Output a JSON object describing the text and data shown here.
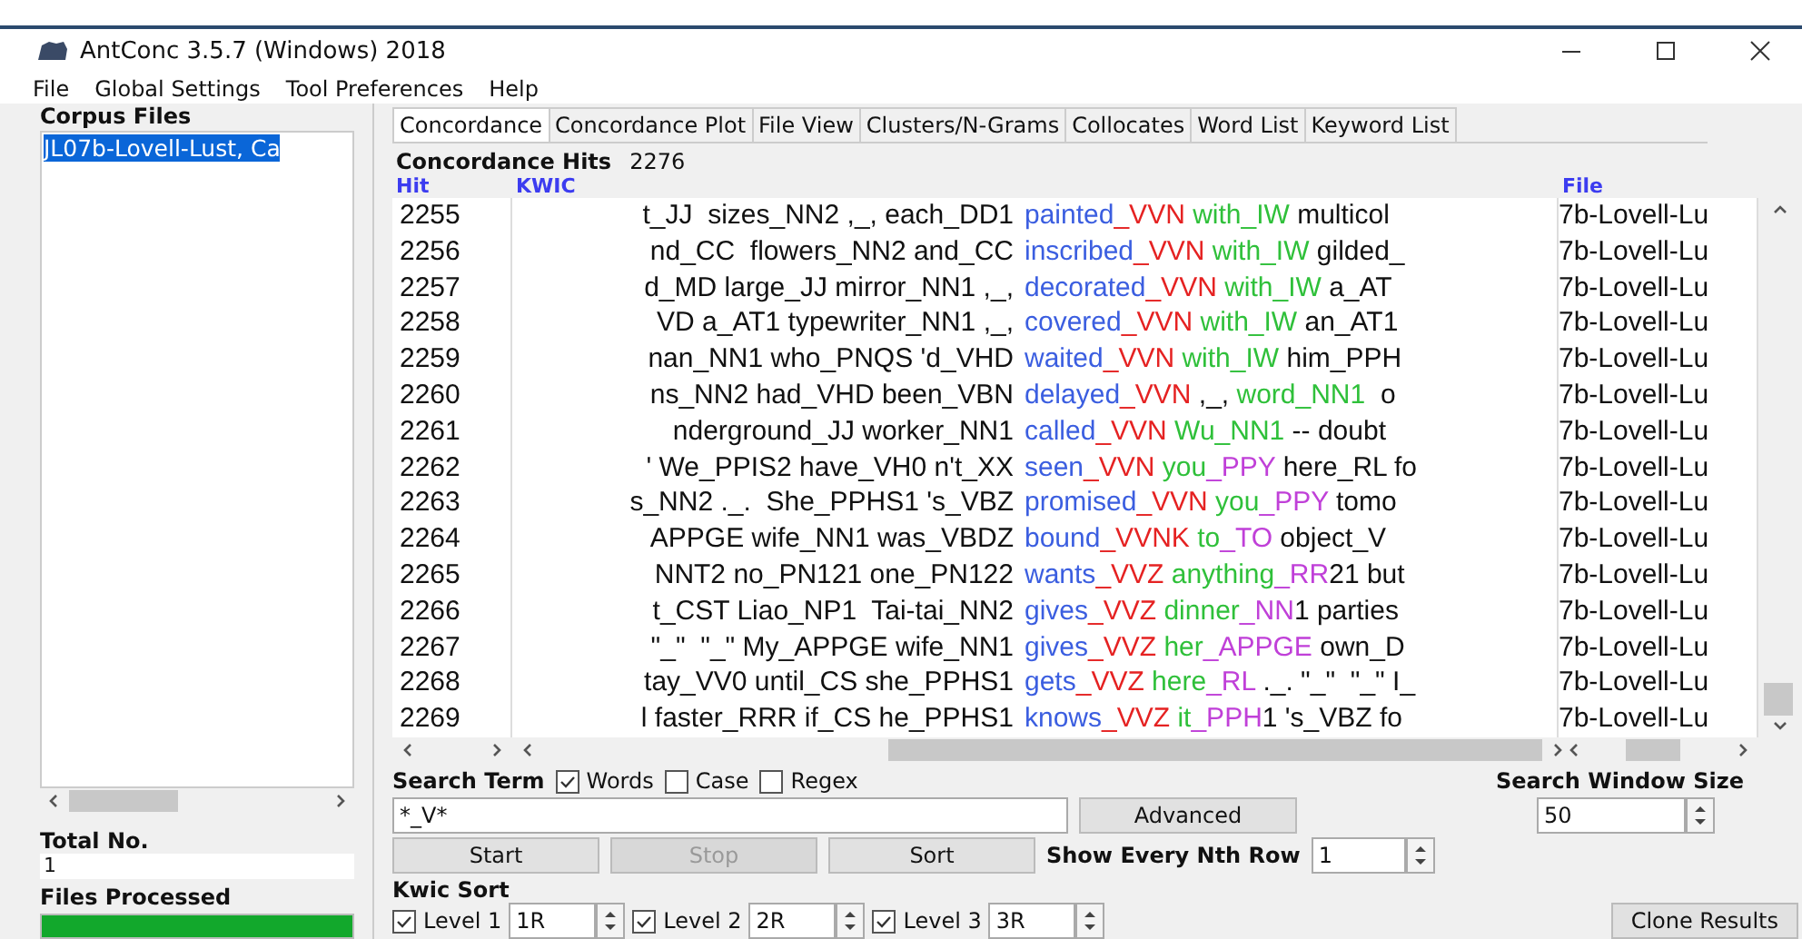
{
  "window": {
    "title": "AntConc 3.5.7 (Windows) 2018"
  },
  "menu": [
    "File",
    "Global Settings",
    "Tool Preferences",
    "Help"
  ],
  "corpus": {
    "label": "Corpus Files",
    "files": [
      {
        "name": "JL07b-Lovell-Lust, Ca",
        "selected": true
      }
    ],
    "total_label": "Total No.",
    "total": "1",
    "processed_label": "Files Processed",
    "progress": {
      "level": 1
    }
  },
  "tabs": [
    {
      "label": "Concordance",
      "selected": true
    },
    {
      "label": "Concordance Plot",
      "selected": false
    },
    {
      "label": "File View",
      "selected": false
    },
    {
      "label": "Clusters/N-Grams",
      "selected": false
    },
    {
      "label": "Collocates",
      "selected": false
    },
    {
      "label": "Word List",
      "selected": false
    },
    {
      "label": "Keyword List",
      "selected": false
    }
  ],
  "hits": {
    "label": "Concordance Hits",
    "count": "2276"
  },
  "table": {
    "columns": [
      "Hit",
      "KWIC",
      "File"
    ],
    "rows": [
      {
        "hit": "2255",
        "left": "t_JJ  sizes_NN2 ,_, each_DD1",
        "right": [
          {
            "text": "painted",
            "color": "#3b5ee0"
          },
          {
            "text": "_VVN",
            "color": "#e52222"
          },
          {
            "text": " with_IW",
            "color": "#2fc03a"
          },
          {
            "text": " multicol",
            "color": "#111111"
          }
        ],
        "file": "7b-Lovell-Lu"
      },
      {
        "hit": "2256",
        "left": "nd_CC  flowers_NN2 and_CC",
        "right": [
          {
            "text": "inscribed",
            "color": "#3b5ee0"
          },
          {
            "text": "_VVN",
            "color": "#e52222"
          },
          {
            "text": " with_IW",
            "color": "#2fc03a"
          },
          {
            "text": " gilded_",
            "color": "#111111"
          }
        ],
        "file": "7b-Lovell-Lu"
      },
      {
        "hit": "2257",
        "left": "d_MD large_JJ mirror_NN1 ,_,",
        "right": [
          {
            "text": "decorated",
            "color": "#3b5ee0"
          },
          {
            "text": "_VVN",
            "color": "#e52222"
          },
          {
            "text": " with_IW",
            "color": "#2fc03a"
          },
          {
            "text": " a_AT",
            "color": "#111111"
          }
        ],
        "file": "7b-Lovell-Lu"
      },
      {
        "hit": "2258",
        "left": "VD a_AT1 typewriter_NN1 ,_,",
        "right": [
          {
            "text": "covered",
            "color": "#3b5ee0"
          },
          {
            "text": "_VVN",
            "color": "#e52222"
          },
          {
            "text": " with_IW",
            "color": "#2fc03a"
          },
          {
            "text": " an_AT1",
            "color": "#111111"
          }
        ],
        "file": "7b-Lovell-Lu"
      },
      {
        "hit": "2259",
        "left": "nan_NN1 who_PNQS 'd_VHD",
        "right": [
          {
            "text": "waited",
            "color": "#3b5ee0"
          },
          {
            "text": "_VVN",
            "color": "#e52222"
          },
          {
            "text": " with_IW",
            "color": "#2fc03a"
          },
          {
            "text": " him_PPH",
            "color": "#111111"
          }
        ],
        "file": "7b-Lovell-Lu"
      },
      {
        "hit": "2260",
        "left": "ns_NN2 had_VHD been_VBN",
        "right": [
          {
            "text": "delayed",
            "color": "#3b5ee0"
          },
          {
            "text": "_VVN",
            "color": "#e52222"
          },
          {
            "text": " ,_, ",
            "color": "#111111"
          },
          {
            "text": "word_NN1",
            "color": "#2fc03a"
          },
          {
            "text": "  o",
            "color": "#111111"
          }
        ],
        "file": "7b-Lovell-Lu"
      },
      {
        "hit": "2261",
        "left": "nderground_JJ worker_NN1",
        "right": [
          {
            "text": "called",
            "color": "#3b5ee0"
          },
          {
            "text": "_VVN",
            "color": "#e52222"
          },
          {
            "text": " Wu_NN1",
            "color": "#2fc03a"
          },
          {
            "text": " -- doubt",
            "color": "#111111"
          }
        ],
        "file": "7b-Lovell-Lu"
      },
      {
        "hit": "2262",
        "left": "' We_PPIS2 have_VH0 n't_XX",
        "right": [
          {
            "text": "seen",
            "color": "#3b5ee0"
          },
          {
            "text": "_VVN",
            "color": "#e52222"
          },
          {
            "text": " you",
            "color": "#2fc03a"
          },
          {
            "text": "_PPY",
            "color": "#c040d8"
          },
          {
            "text": " here_RL fo",
            "color": "#111111"
          }
        ],
        "file": "7b-Lovell-Lu"
      },
      {
        "hit": "2263",
        "left": "s_NN2 ._.  She_PPHS1 's_VBZ",
        "right": [
          {
            "text": "promised",
            "color": "#3b5ee0"
          },
          {
            "text": "_VVN",
            "color": "#e52222"
          },
          {
            "text": " you",
            "color": "#2fc03a"
          },
          {
            "text": "_PPY",
            "color": "#c040d8"
          },
          {
            "text": " tomo",
            "color": "#111111"
          }
        ],
        "file": "7b-Lovell-Lu"
      },
      {
        "hit": "2264",
        "left": "APPGE wife_NN1 was_VBDZ",
        "right": [
          {
            "text": "bound",
            "color": "#3b5ee0"
          },
          {
            "text": "_VVNK",
            "color": "#e52222"
          },
          {
            "text": " to",
            "color": "#2fc03a"
          },
          {
            "text": "_TO",
            "color": "#c040d8"
          },
          {
            "text": " object_V",
            "color": "#111111"
          }
        ],
        "file": "7b-Lovell-Lu"
      },
      {
        "hit": "2265",
        "left": "NNT2 no_PN121 one_PN122",
        "right": [
          {
            "text": "wants",
            "color": "#3b5ee0"
          },
          {
            "text": "_VVZ",
            "color": "#e52222"
          },
          {
            "text": " anything",
            "color": "#2fc03a"
          },
          {
            "text": "_RR",
            "color": "#c040d8"
          },
          {
            "text": "21 but",
            "color": "#111111"
          }
        ],
        "file": "7b-Lovell-Lu"
      },
      {
        "hit": "2266",
        "left": "t_CST Liao_NP1  Tai-tai_NN2",
        "right": [
          {
            "text": "gives",
            "color": "#3b5ee0"
          },
          {
            "text": "_VVZ",
            "color": "#e52222"
          },
          {
            "text": " dinner",
            "color": "#2fc03a"
          },
          {
            "text": "_NN",
            "color": "#c040d8"
          },
          {
            "text": "1 parties",
            "color": "#111111"
          }
        ],
        "file": "7b-Lovell-Lu"
      },
      {
        "hit": "2267",
        "left": "\"_\"  \"_\" My_APPGE wife_NN1",
        "right": [
          {
            "text": "gives",
            "color": "#3b5ee0"
          },
          {
            "text": "_VVZ",
            "color": "#e52222"
          },
          {
            "text": " her",
            "color": "#2fc03a"
          },
          {
            "text": "_APPGE",
            "color": "#c040d8"
          },
          {
            "text": " own_D",
            "color": "#111111"
          }
        ],
        "file": "7b-Lovell-Lu"
      },
      {
        "hit": "2268",
        "left": "tay_VV0 until_CS she_PPHS1",
        "right": [
          {
            "text": "gets",
            "color": "#3b5ee0"
          },
          {
            "text": "_VVZ",
            "color": "#e52222"
          },
          {
            "text": " here",
            "color": "#2fc03a"
          },
          {
            "text": "_RL",
            "color": "#c040d8"
          },
          {
            "text": " ._. \"_\"  \"_\" I_",
            "color": "#111111"
          }
        ],
        "file": "7b-Lovell-Lu"
      },
      {
        "hit": "2269",
        "left": "l faster_RRR if_CS he_PPHS1",
        "right": [
          {
            "text": "knows",
            "color": "#3b5ee0"
          },
          {
            "text": "_VVZ",
            "color": "#e52222"
          },
          {
            "text": " it",
            "color": "#2fc03a"
          },
          {
            "text": "_PPH",
            "color": "#c040d8"
          },
          {
            "text": "1 's_VBZ fo",
            "color": "#111111"
          }
        ],
        "file": "7b-Lovell-Lu"
      }
    ]
  },
  "search": {
    "label": "Search Term",
    "options": [
      {
        "label": "Words",
        "checked": true
      },
      {
        "label": "Case",
        "checked": false
      },
      {
        "label": "Regex",
        "checked": false
      }
    ],
    "value": "*_V*",
    "advanced": "Advanced"
  },
  "buttons": [
    {
      "label": "Start",
      "disabled": false
    },
    {
      "label": "Stop",
      "disabled": true
    },
    {
      "label": "Sort",
      "disabled": false
    }
  ],
  "nth_row": {
    "label": "Show Every Nth Row",
    "value": "1"
  },
  "window_size": {
    "label": "Search Window Size",
    "value": "50"
  },
  "kwic_sort": {
    "label": "Kwic Sort",
    "levels": [
      {
        "label": "Level 1",
        "value": "1R",
        "checked": true
      },
      {
        "label": "Level 2",
        "value": "2R",
        "checked": true
      },
      {
        "label": "Level 3",
        "value": "3R",
        "checked": true
      }
    ]
  },
  "clone": "Clone Results"
}
